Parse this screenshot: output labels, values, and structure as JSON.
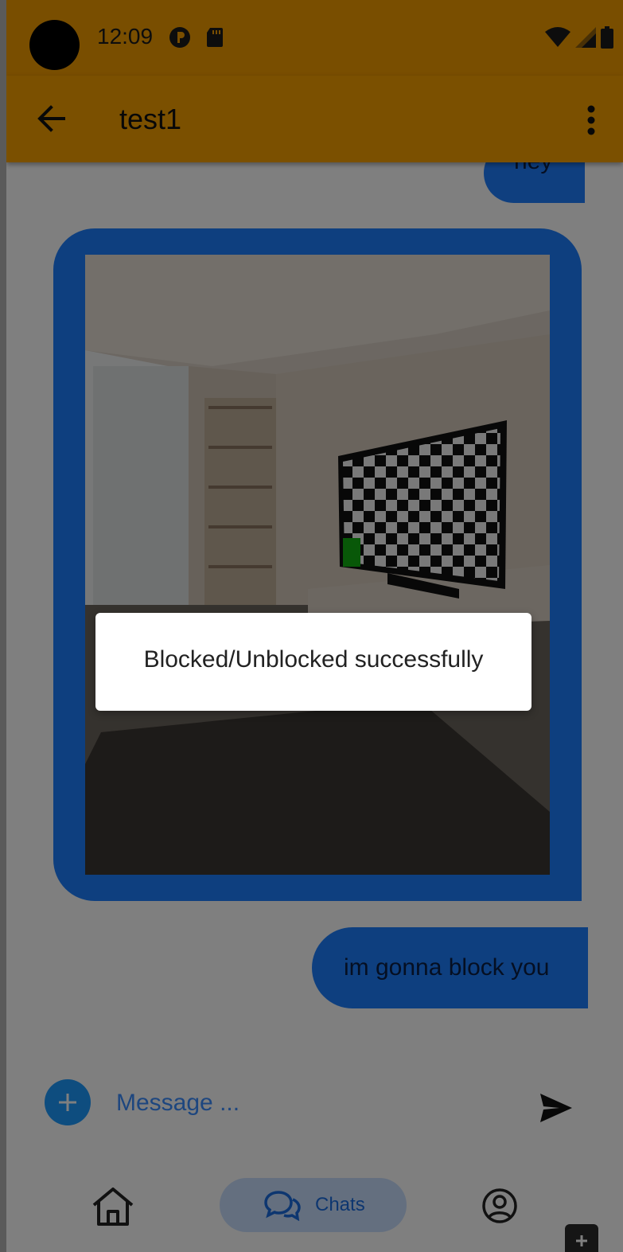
{
  "status_bar": {
    "time": "12:09",
    "icons": [
      "clock-app-icon",
      "sd-card-icon"
    ],
    "right_icons": [
      "wifi-icon",
      "signal-icon",
      "battery-icon"
    ]
  },
  "app_bar": {
    "title": "test1",
    "back_icon": "arrow-back-icon",
    "menu_icon": "more-vert-icon"
  },
  "messages": [
    {
      "type": "text",
      "text": "hey",
      "sender": "me"
    },
    {
      "type": "image",
      "sender": "me",
      "image_desc_icon": "room-photo"
    },
    {
      "type": "text",
      "text": "im gonna block you",
      "sender": "me"
    }
  ],
  "composer": {
    "placeholder": "Message ...",
    "attach_icon": "plus-icon",
    "send_icon": "send-icon"
  },
  "bottom_nav": {
    "items": [
      {
        "icon": "home-icon",
        "label": ""
      },
      {
        "icon": "chats-icon",
        "label": "Chats",
        "active": true
      },
      {
        "icon": "profile-icon",
        "label": ""
      }
    ],
    "fab_icon": "plus-icon"
  },
  "toast": {
    "text": "Blocked/Unblocked successfully"
  },
  "colors": {
    "status_bar": "#f29c00",
    "app_bar": "#f7a000",
    "bubble": "#1c7fff",
    "accent": "#1c9bff"
  }
}
